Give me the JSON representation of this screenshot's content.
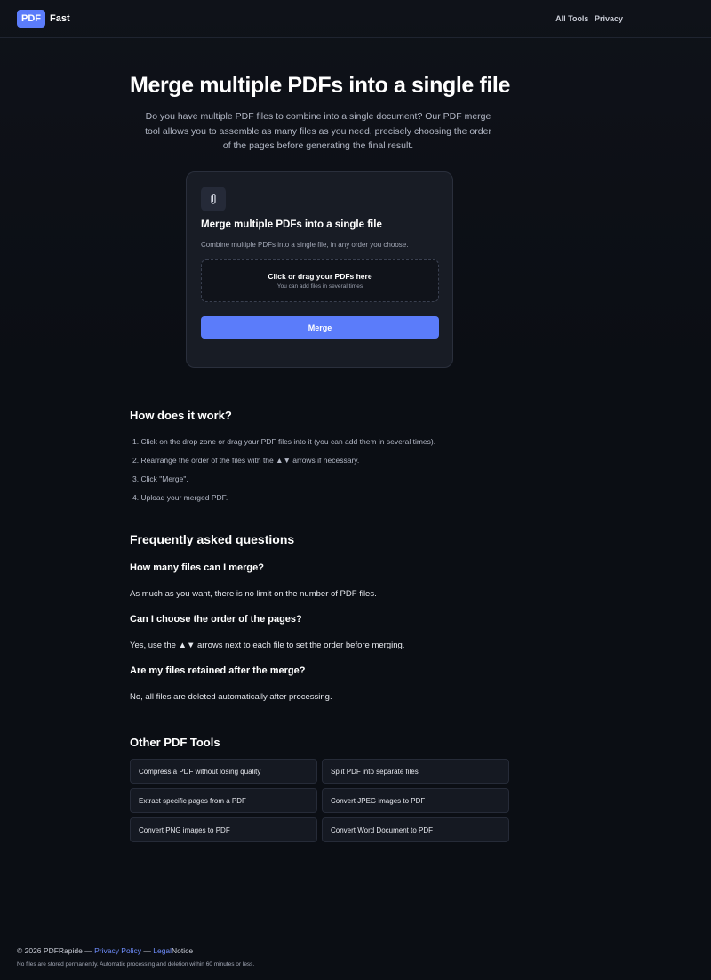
{
  "header": {
    "logo_badge": "PDF",
    "logo_text": "Fast",
    "nav": [
      "All Tools",
      "Privacy"
    ]
  },
  "hero": {
    "title": "Merge multiple PDFs into a single file",
    "description": "Do you have multiple PDF files to combine into a single document? Our PDF merge tool allows you to assemble as many files as you need, precisely choosing the order of the pages before generating the final result."
  },
  "card": {
    "icon": "paperclip-icon",
    "title": "Merge multiple PDFs into a single file",
    "subtitle": "Combine multiple PDFs into a single file, in any order you choose.",
    "dropzone_main": "Click or drag your PDFs here",
    "dropzone_sub": "You can add files in several times",
    "button": "Merge"
  },
  "how": {
    "title": "How does it work?",
    "steps": [
      "1. Click on the drop zone or drag your PDF files into it (you can add them in several times).",
      "2. Rearrange the order of the files with the ▲▼ arrows if necessary.",
      "3. Click \"Merge\".",
      "4. Upload your merged PDF."
    ]
  },
  "faq": {
    "title": "Frequently asked questions",
    "items": [
      {
        "q": "How many files can I merge?",
        "a": "As much as you want, there is no limit on the number of PDF files."
      },
      {
        "q": "Can I choose the order of the pages?",
        "a": "Yes, use the ▲▼ arrows next to each file to set the order before merging."
      },
      {
        "q": "Are my files retained after the merge?",
        "a": "No, all files are deleted automatically after processing."
      }
    ]
  },
  "tools": {
    "title": "Other PDF Tools",
    "items": [
      "Compress a PDF without losing quality",
      "Split PDF into separate files",
      "Extract specific pages from a PDF",
      "Convert JPEG images to PDF",
      "Convert PNG images to PDF",
      "Convert Word Document to PDF"
    ]
  },
  "footer": {
    "copyright": "© 2026 PDFRapide —",
    "privacy_link": "Privacy Policy",
    "sep": "—",
    "legal_link": "Legal",
    "legal_rest": "Notice",
    "note": "No files are stored permanently. Automatic processing and deletion within 60 minutes or less."
  },
  "colors": {
    "accent": "#5b7cfa",
    "background": "#0b0e14",
    "card": "#181c25",
    "link": "#6f8dfc"
  }
}
